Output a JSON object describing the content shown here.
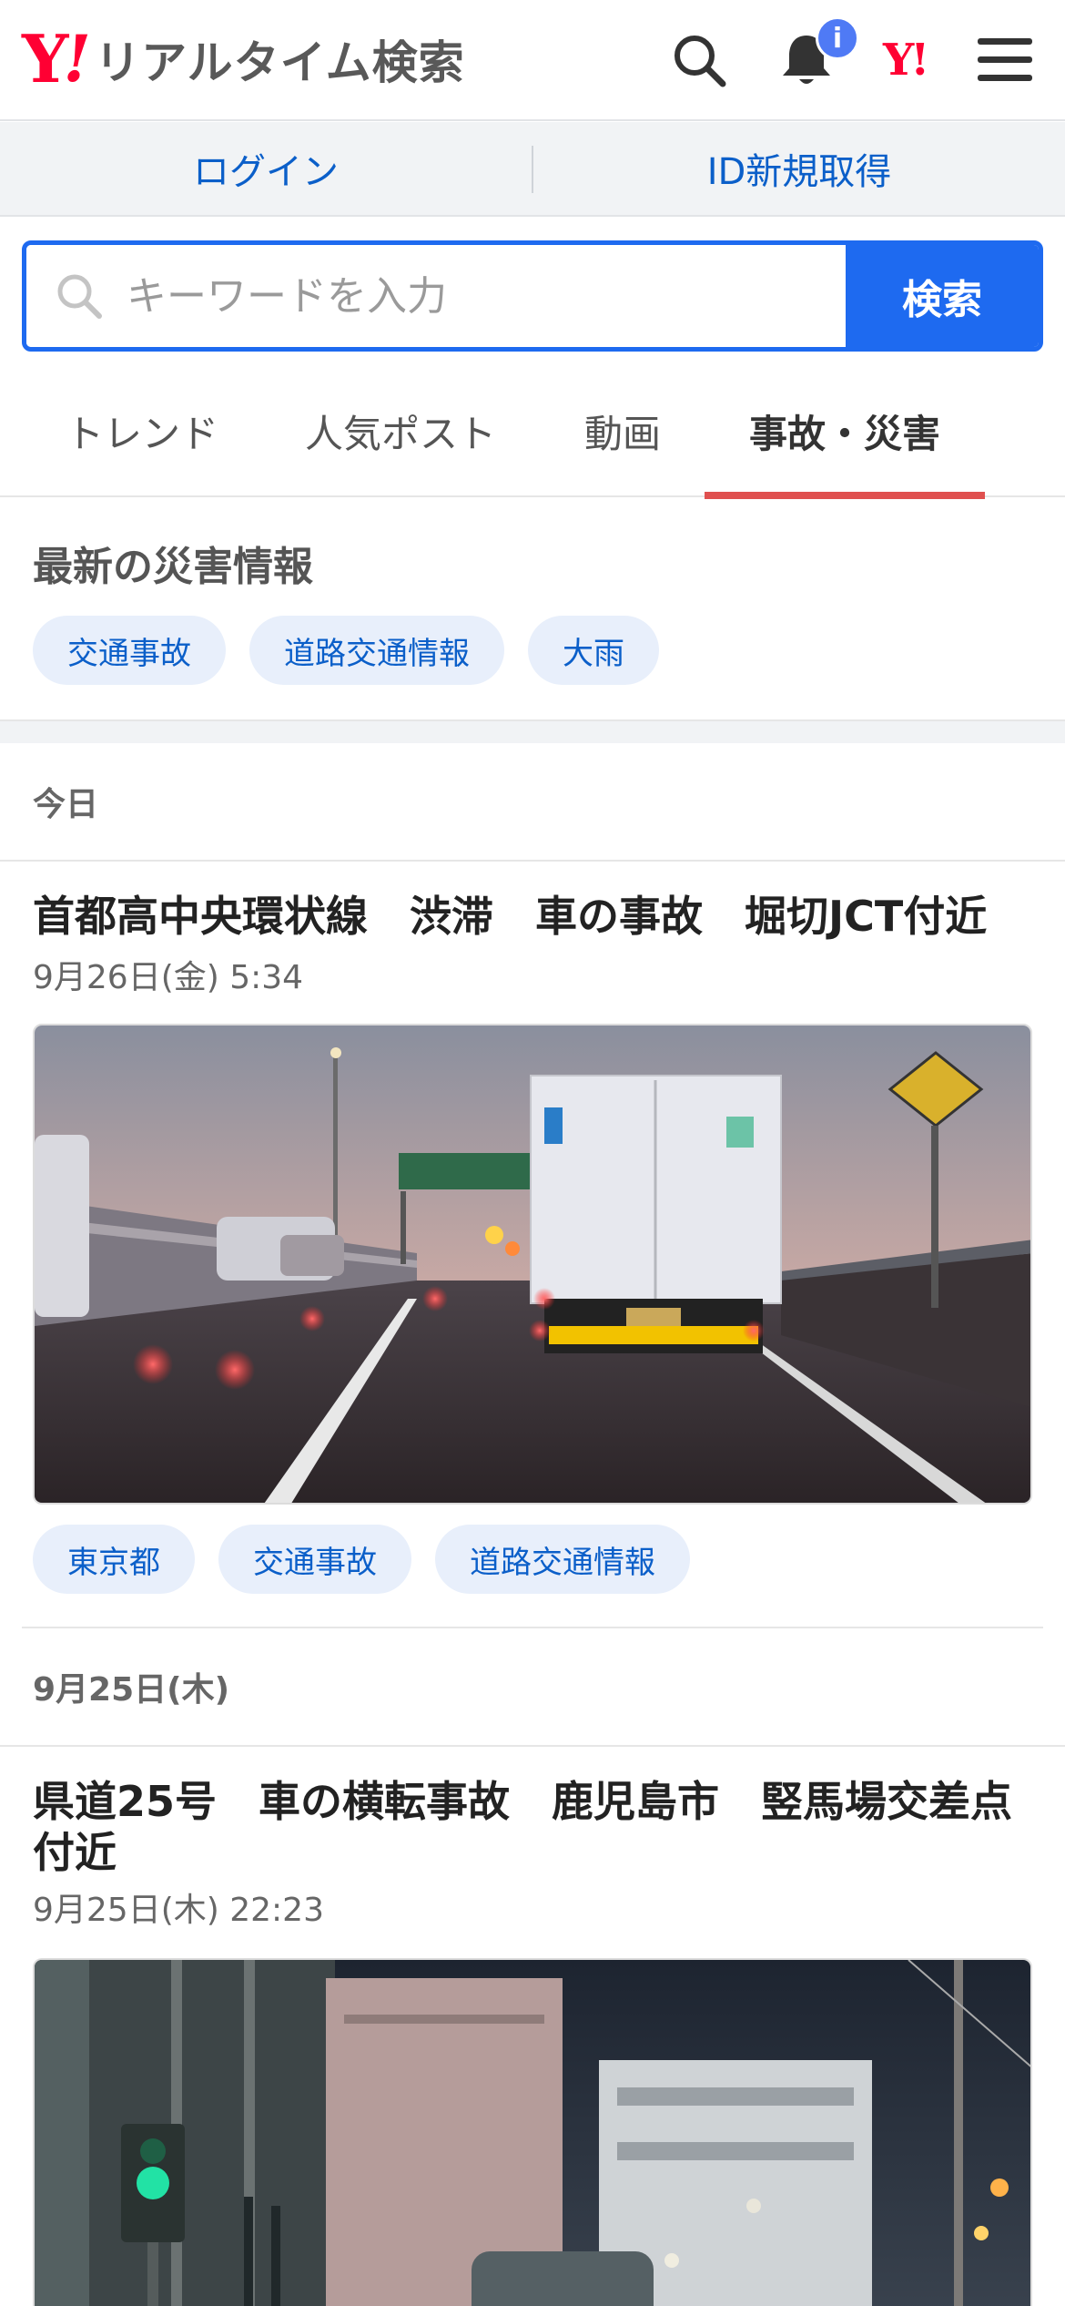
{
  "header": {
    "logo_mark": "Y",
    "logo_exclaim": "!",
    "logo_text": "リアルタイム検索",
    "badge": "i",
    "yahoo_small": "Y!",
    "icons": [
      "search-icon",
      "bell-icon",
      "yahoo-logo-icon",
      "hamburger-menu-icon"
    ]
  },
  "loginbar": {
    "login": "ログイン",
    "register": "ID新規取得"
  },
  "search": {
    "placeholder": "キーワードを入力",
    "button": "検索"
  },
  "tabs": [
    {
      "label": "トレンド",
      "active": false
    },
    {
      "label": "人気ポスト",
      "active": false
    },
    {
      "label": "動画",
      "active": false
    },
    {
      "label": "事故・災害",
      "active": true
    }
  ],
  "disaster": {
    "title": "最新の災害情報",
    "chips": [
      "交通事故",
      "道路交通情報",
      "大雨"
    ]
  },
  "feed": {
    "date1": "今日",
    "article1": {
      "title": "首都高中央環状線　渋滞　車の事故　堀切JCT付近",
      "time": "9月26日(金) 5:34",
      "chips": [
        "東京都",
        "交通事故",
        "道路交通情報"
      ]
    },
    "date2": "9月25日(木)",
    "article2": {
      "title": "県道25号　車の横転事故　鹿児島市　竪馬場交差点付近",
      "time": "9月25日(木) 22:23"
    }
  },
  "colors": {
    "brand_red": "#ff0033",
    "link_blue": "#0b5fc9",
    "search_blue": "#1e6af0",
    "tab_underline": "#e0504f",
    "chip_bg": "#e8effb"
  }
}
